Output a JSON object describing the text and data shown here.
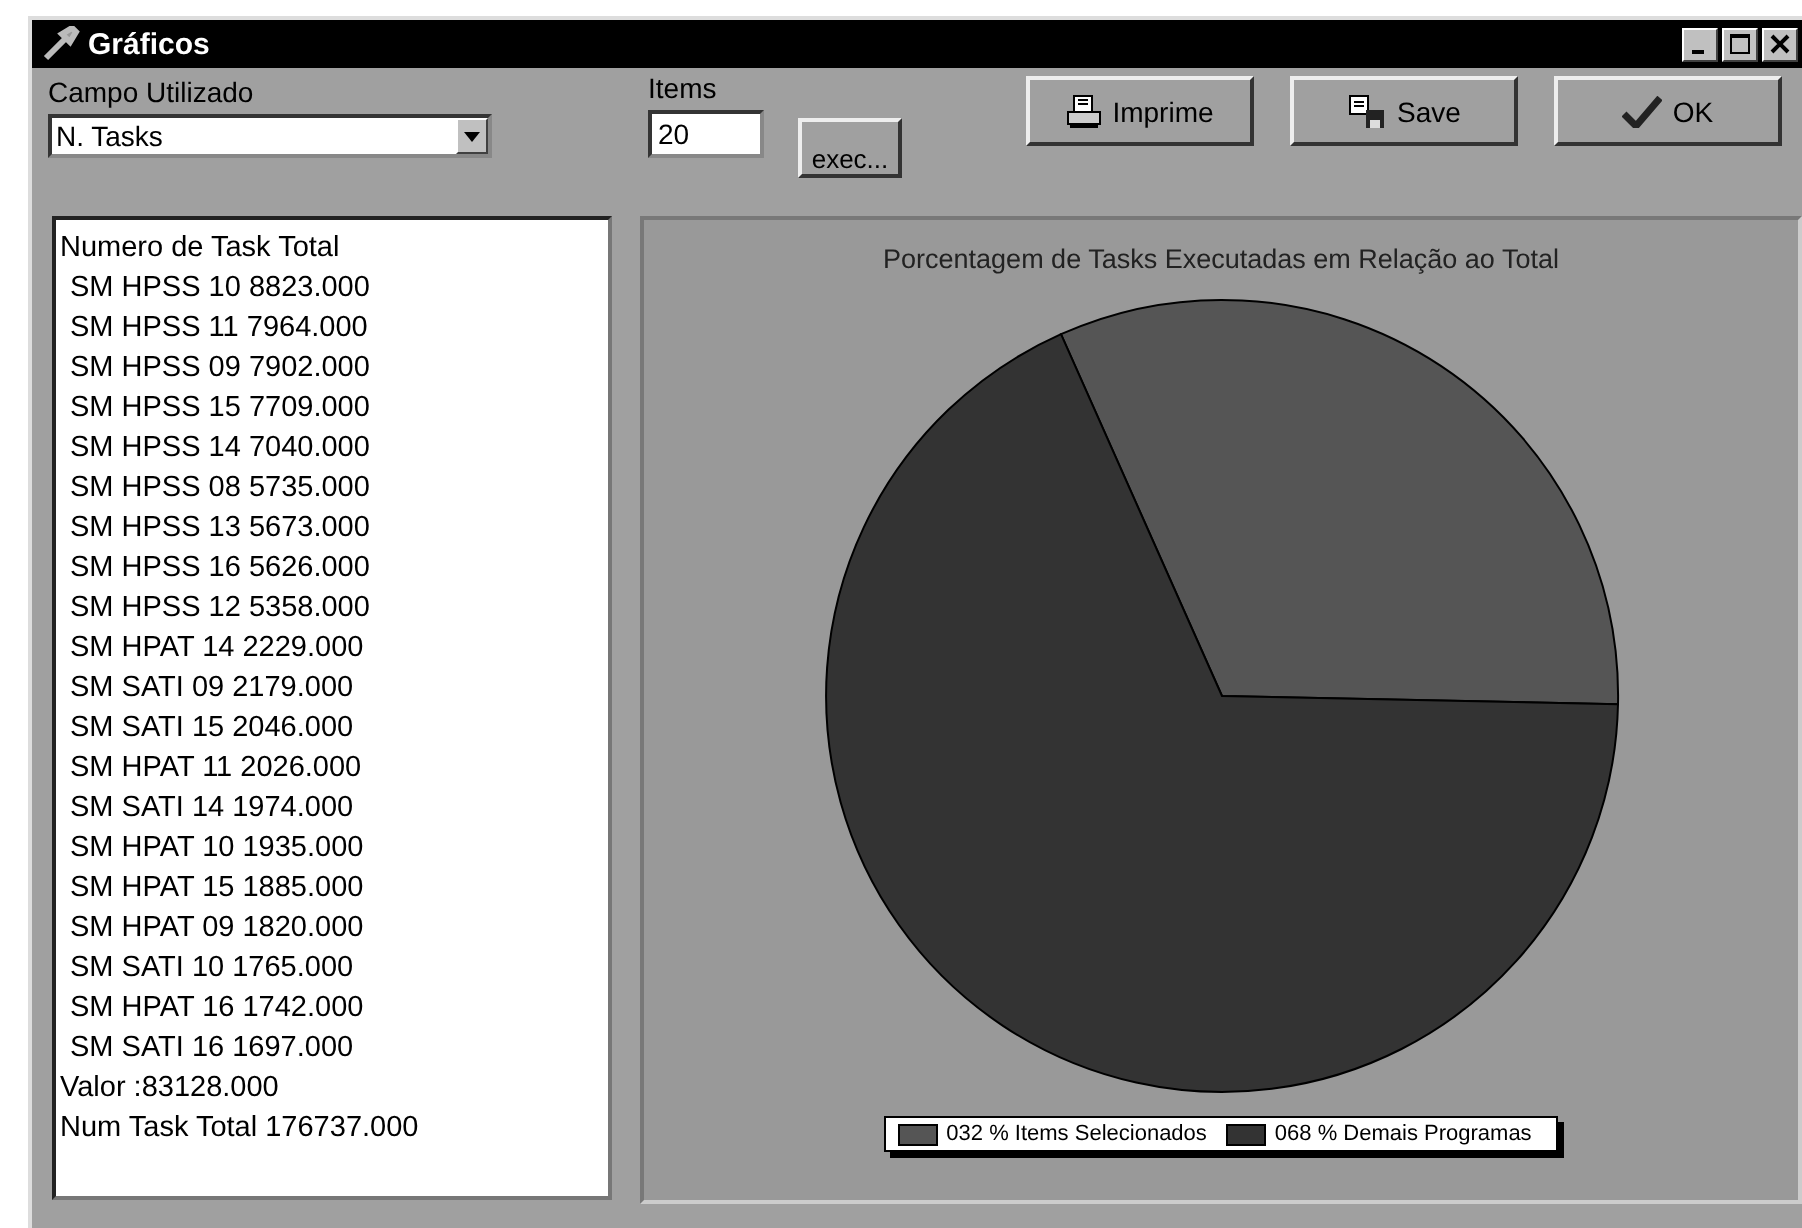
{
  "window": {
    "title": "Gráficos"
  },
  "campo": {
    "label": "Campo Utilizado",
    "value": "N. Tasks"
  },
  "items": {
    "label": "Items",
    "value": "20"
  },
  "buttons": [
    {
      "kind": "exec",
      "label": "exec..."
    },
    {
      "kind": "print",
      "label": "Imprime"
    },
    {
      "kind": "save",
      "label": "Save"
    },
    {
      "kind": "ok",
      "label": "OK"
    }
  ],
  "list": [
    {
      "text": "Numero de Task Total",
      "indented": false
    },
    {
      "text": "SM HPSS 10 8823.000",
      "indented": true
    },
    {
      "text": "SM HPSS 11 7964.000",
      "indented": true
    },
    {
      "text": "SM HPSS 09 7902.000",
      "indented": true
    },
    {
      "text": "SM HPSS 15 7709.000",
      "indented": true
    },
    {
      "text": "SM HPSS 14 7040.000",
      "indented": true
    },
    {
      "text": "SM HPSS 08 5735.000",
      "indented": true
    },
    {
      "text": "SM HPSS 13 5673.000",
      "indented": true
    },
    {
      "text": "SM HPSS 16 5626.000",
      "indented": true
    },
    {
      "text": "SM HPSS 12 5358.000",
      "indented": true
    },
    {
      "text": "SM HPAT 14 2229.000",
      "indented": true
    },
    {
      "text": "SM SATI 09 2179.000",
      "indented": true
    },
    {
      "text": "SM SATI 15 2046.000",
      "indented": true
    },
    {
      "text": "SM HPAT 11 2026.000",
      "indented": true
    },
    {
      "text": "SM SATI 14 1974.000",
      "indented": true
    },
    {
      "text": "SM HPAT 10 1935.000",
      "indented": true
    },
    {
      "text": "SM HPAT 15 1885.000",
      "indented": true
    },
    {
      "text": "SM HPAT 09 1820.000",
      "indented": true
    },
    {
      "text": "SM SATI 10 1765.000",
      "indented": true
    },
    {
      "text": "SM HPAT 16 1742.000",
      "indented": true
    },
    {
      "text": "SM SATI 16 1697.000",
      "indented": true
    },
    {
      "text": "Valor :83128.000",
      "indented": false
    },
    {
      "text": "Num Task Total 176737.000",
      "indented": false
    }
  ],
  "chart": {
    "chart_data": {
      "type": "pie",
      "title": "Porcentagem de Tasks Executadas em Relação ao Total",
      "values": [
        32,
        68
      ]
    },
    "legend": [
      {
        "label": "032 % Items Selecionados",
        "color": "#555555"
      },
      {
        "label": "068 % Demais Programas",
        "color": "#333333"
      }
    ]
  }
}
